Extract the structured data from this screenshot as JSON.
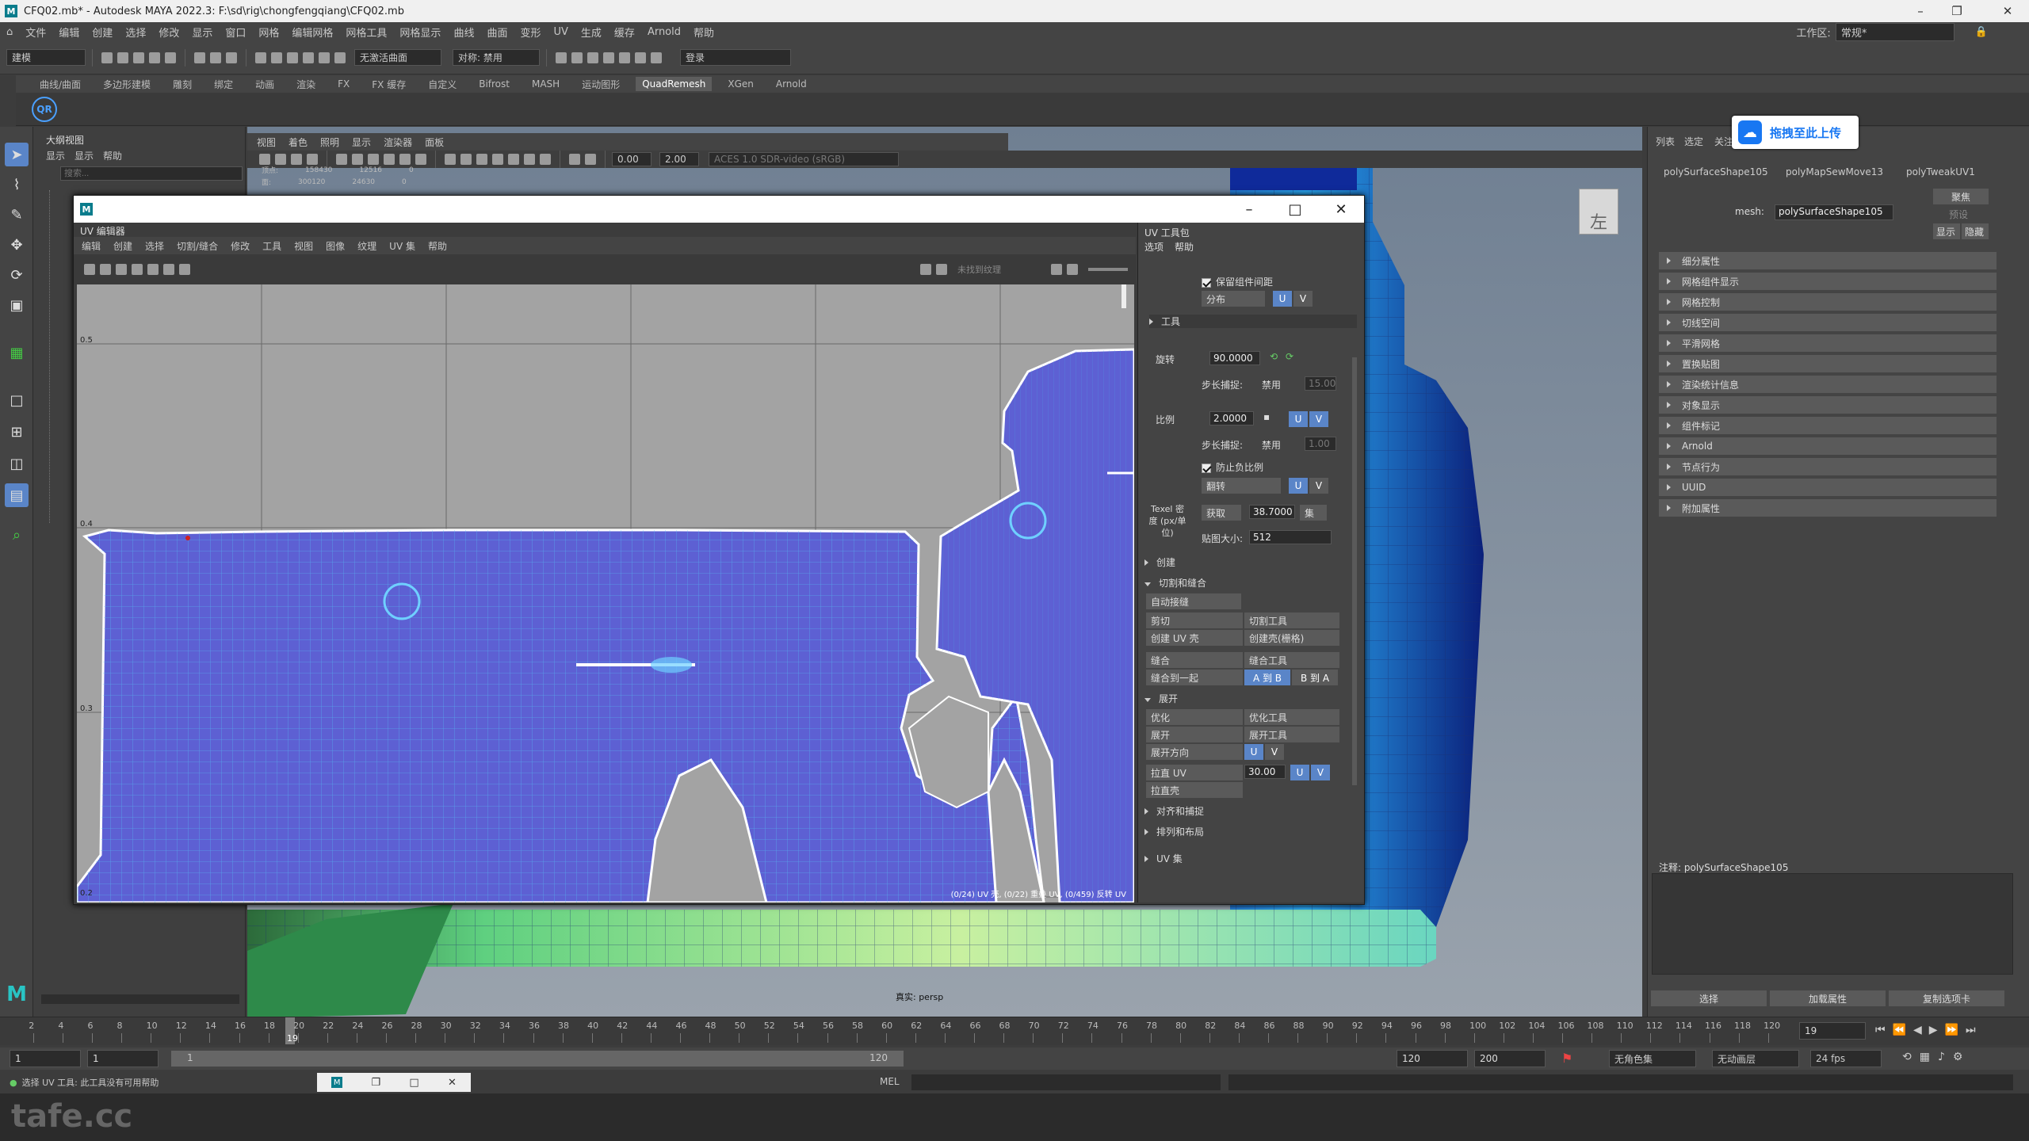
{
  "window": {
    "title": "CFQ02.mb* - Autodesk MAYA 2022.3: F:\\sd\\rig\\chongfengqiang\\CFQ02.mb",
    "logo": "M",
    "minimize": "–",
    "maximize": "❐",
    "close": "✕"
  },
  "menubar": {
    "items": [
      "文件",
      "编辑",
      "创建",
      "选择",
      "修改",
      "显示",
      "窗口",
      "网格",
      "编辑网格",
      "网格工具",
      "网格显示",
      "曲线",
      "曲面",
      "变形",
      "UV",
      "生成",
      "缓存",
      "Arnold",
      "帮助"
    ],
    "workspace_label": "工作区:",
    "workspace_value": "常规*"
  },
  "statusline": {
    "mode": "建模",
    "snap_surface": "无激活曲面",
    "symmetry_label": "对称: 禁用",
    "login": "登录"
  },
  "shelf": {
    "tabs": [
      "曲线/曲面",
      "多边形建模",
      "雕刻",
      "绑定",
      "动画",
      "渲染",
      "FX",
      "FX 缓存",
      "自定义",
      "Bifrost",
      "MASH",
      "运动图形",
      "QuadRemesh",
      "XGen",
      "Arnold"
    ],
    "active_tab": "QuadRemesh",
    "qr_label": "QR"
  },
  "outliner": {
    "title": "大纲视图",
    "menu": [
      "显示",
      "显示",
      "帮助"
    ],
    "search_placeholder": "搜索..."
  },
  "viewport": {
    "menu": [
      "视图",
      "着色",
      "照明",
      "显示",
      "渲染器",
      "面板"
    ],
    "field1": "0.00",
    "field2": "2.00",
    "color_space": "ACES 1.0 SDR-video (sRGB)",
    "camera_label": "真实: persp",
    "stats": [
      [
        "顶点:",
        "158430",
        "12516",
        "0"
      ],
      [
        "面:",
        "300120",
        "24630",
        "0"
      ]
    ],
    "view_cube_label": "左"
  },
  "uv_editor": {
    "title": "UV 编辑器",
    "menu": [
      "编辑",
      "创建",
      "选择",
      "切割/缝合",
      "修改",
      "工具",
      "视图",
      "图像",
      "纹理",
      "UV 集",
      "帮助"
    ],
    "texture_dropdown": "未找到纹理",
    "grid_labels": [
      "0.5",
      "0.4",
      "0.3",
      "0.2"
    ],
    "status": "(0/24) UV 壳, (0/22) 重叠 UV, (0/459) 反转 UV"
  },
  "toolkit": {
    "title": "UV 工具包",
    "menu": [
      "选项",
      "帮助"
    ],
    "keep_gap": "保留组件间距",
    "distribute": "分布",
    "tools_header": "工具",
    "rotate_label": "旋转",
    "rotate_value": "90.0000",
    "step_snap": "步长捕捉:",
    "disabled": "禁用",
    "step_value1": "15.00",
    "scale_label": "比例",
    "scale_value": "2.0000",
    "step_value2": "1.00",
    "prevent_negative": "防止负比例",
    "flip": "翻转",
    "texel_label": "Texel 密度 (px/单位)",
    "get": "获取",
    "texel_value": "38.7000",
    "set": "集",
    "map_size_label": "贴图大小:",
    "map_size_value": "512",
    "sections": {
      "create": "创建",
      "cut_sew": "切割和缝合",
      "unfold": "展开",
      "align": "对齐和捕捉",
      "arrange": "排列和布局",
      "uvsets": "UV 集"
    },
    "auto_seams": "自动接缝",
    "cut": "剪切",
    "cut_tool": "切割工具",
    "create_shell": "创建 UV 壳",
    "create_shell_grid": "创建壳(栅格)",
    "sew": "缝合",
    "sew_tool": "缝合工具",
    "sew_together": "缝合到一起",
    "a_to_b": "A 到 B",
    "b_to_a": "B 到 A",
    "optimize": "优化",
    "optimize_tool": "优化工具",
    "unfold_btn": "展开",
    "unfold_tool": "展开工具",
    "unfold_direction": "展开方向",
    "straighten_uv": "拉直 UV",
    "straighten_value": "30.00",
    "straighten_shell": "拉直壳",
    "u": "U",
    "v": "V"
  },
  "attribute_editor": {
    "side_tabs": [
      "列表",
      "选定",
      "关注"
    ],
    "tabs": [
      "polySurfaceShape105",
      "polyMapSewMove13",
      "polyTweakUV1"
    ],
    "mesh_label": "mesh:",
    "mesh_value": "polySurfaceShape105",
    "focus": "聚焦",
    "presets": "预设",
    "show": "显示",
    "hide": "隐藏",
    "sections": [
      "细分属性",
      "网格组件显示",
      "网格控制",
      "切线空间",
      "平滑网格",
      "置换贴图",
      "渲染统计信息",
      "对象显示",
      "组件标记",
      "Arnold",
      "节点行为",
      "UUID",
      "附加属性"
    ],
    "notes_label": "注释: polySurfaceShape105",
    "buttons": [
      "选择",
      "加载属性",
      "复制选项卡"
    ]
  },
  "upload_button": "拖拽至此上传",
  "timeline": {
    "ticks": [
      "2",
      "4",
      "6",
      "8",
      "10",
      "12",
      "14",
      "16",
      "18",
      "20",
      "22",
      "24",
      "26",
      "28",
      "30",
      "32",
      "34",
      "36",
      "38",
      "40",
      "42",
      "44",
      "46",
      "48",
      "50",
      "52",
      "54",
      "56",
      "58",
      "60",
      "62",
      "64",
      "66",
      "68",
      "70",
      "72",
      "74",
      "76",
      "78",
      "80",
      "82",
      "84",
      "86",
      "88",
      "90",
      "92",
      "94",
      "96",
      "98",
      "100",
      "102",
      "104",
      "106",
      "108",
      "110",
      "112",
      "114",
      "116",
      "118",
      "120"
    ],
    "current_frame": "19",
    "current_field": "19",
    "range_start": "1",
    "range_start2": "1",
    "range_inner_start": "1",
    "range_inner_end": "120",
    "range_end": "120",
    "anim_end": "200",
    "no_character": "无角色集",
    "no_anim_layer": "无动画层",
    "fps": "24 fps"
  },
  "command": {
    "lang": "MEL",
    "help_text": "选择 UV 工具: 此工具没有可用帮助"
  },
  "watermark": "tafe.cc"
}
